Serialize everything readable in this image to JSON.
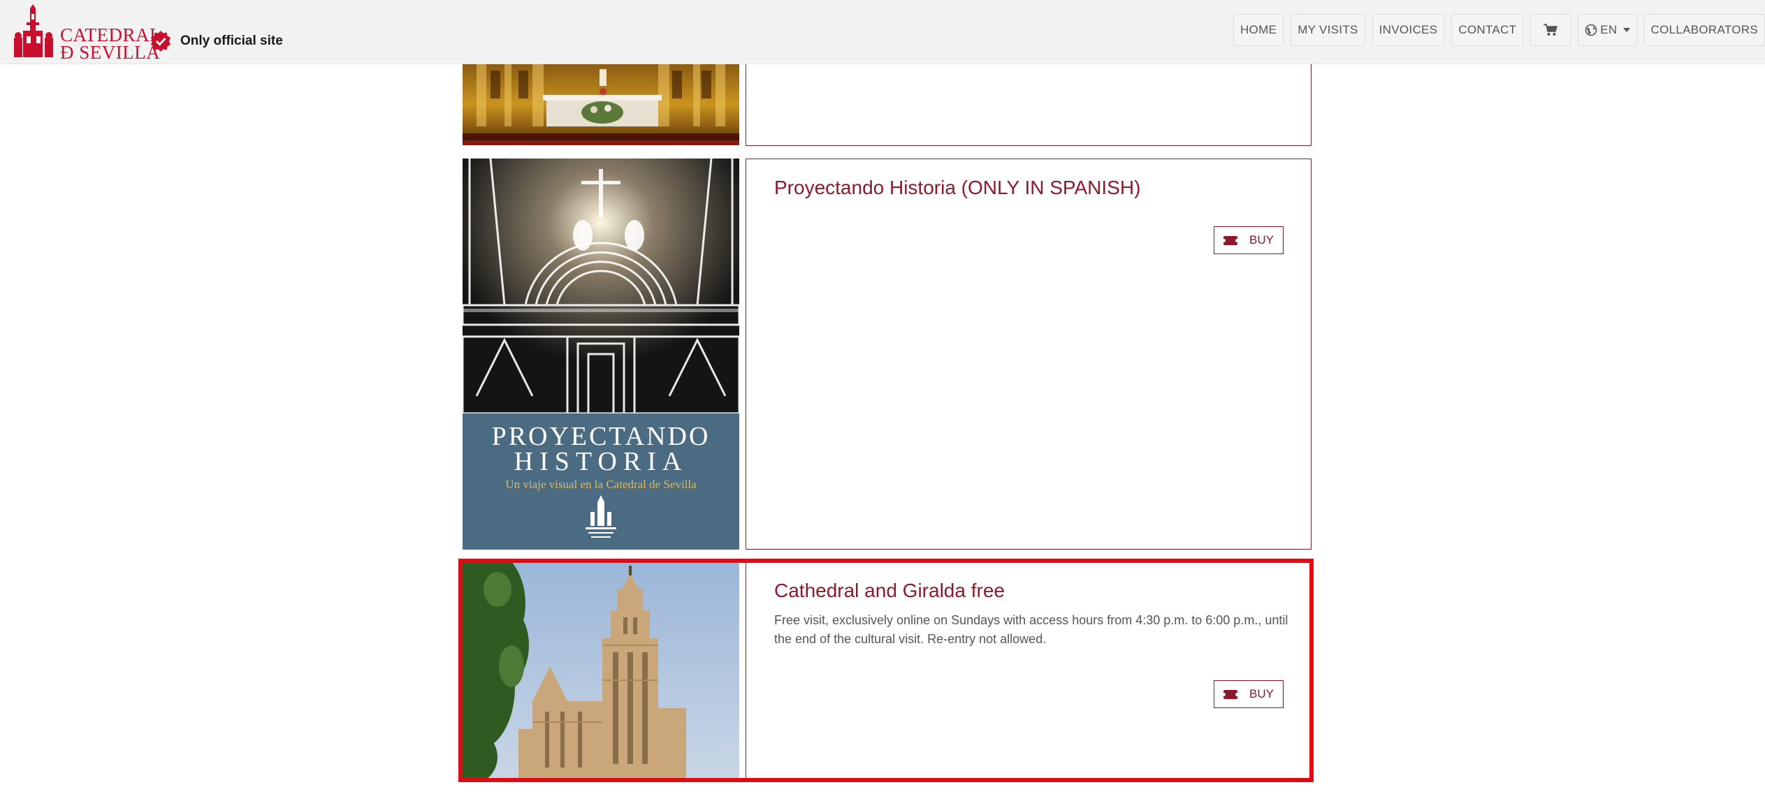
{
  "header": {
    "logo_line1": "CATEDRAL",
    "logo_line2": "Ð SEVILLA",
    "official_label": "Only official site",
    "nav": [
      "HOME",
      "MY VISITS",
      "INVOICES",
      "CONTACT"
    ],
    "language": "EN",
    "collaborators": "COLLABORATORS"
  },
  "cards": [
    {
      "title": "Proyectando Historia (ONLY IN SPANISH)",
      "buy_label": "BUY",
      "poster_title1": "PROYECTANDO",
      "poster_title2": "HISTORIA",
      "poster_subtitle": "Un viaje visual en la Catedral de Sevilla"
    },
    {
      "title": "Cathedral and Giralda free",
      "description": "Free visit, exclusively online on Sundays with access hours from 4:30 p.m. to 6:00 p.m., until the end of the cultural visit. Re-entry not allowed.",
      "buy_label": "BUY"
    }
  ],
  "colors": {
    "brand": "#c8102e",
    "accent": "#8b1a2b",
    "highlight": "#e20b14"
  }
}
